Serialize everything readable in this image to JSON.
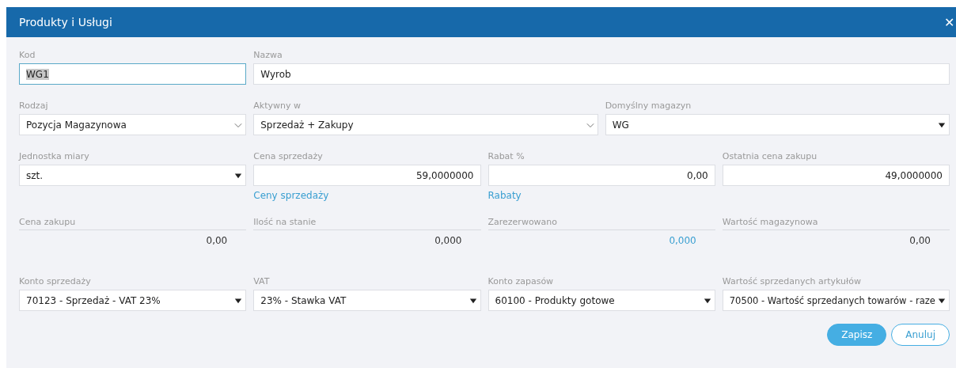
{
  "window": {
    "title": "Produkty i Usługi",
    "close": "✕"
  },
  "rows": [
    {
      "fields": [
        {
          "kind": "text",
          "label": "Kod",
          "value": "WG1",
          "focused": true
        },
        {
          "kind": "text",
          "label": "Nazwa",
          "value": "Wyrob",
          "focused": false
        }
      ]
    },
    {
      "fields": [
        {
          "kind": "select",
          "label": "Rodzaj",
          "value": "Pozycja Magazynowa"
        },
        {
          "kind": "select",
          "label": "Aktywny w",
          "value": "Sprzedaż + Zakupy"
        },
        {
          "kind": "dropdown",
          "label": "Domyślny magazyn",
          "value": "WG"
        }
      ]
    },
    {
      "fields": [
        {
          "kind": "dropdown",
          "label": "Jednostka miary",
          "value": "szt."
        },
        {
          "kind": "number",
          "label": "Cena sprzedaży",
          "value": "59,0000000",
          "focused": false,
          "link": "Ceny sprzedaży"
        },
        {
          "kind": "number",
          "label": "Rabat %",
          "value": "0,00",
          "focused": false,
          "link": "Rabaty"
        },
        {
          "kind": "number",
          "label": "Ostatnia cena zakupu",
          "value": "49,0000000",
          "focused": false
        }
      ]
    },
    {
      "fields": [
        {
          "kind": "readonly",
          "label": "Cena zakupu",
          "value": "0,00",
          "linked": false
        },
        {
          "kind": "readonly",
          "label": "Ilość na stanie",
          "value": "0,000",
          "linked": false
        },
        {
          "kind": "readonly",
          "label": "Zarezerwowano",
          "value": "0,000",
          "linked": true
        },
        {
          "kind": "readonly",
          "label": "Wartość magazynowa",
          "value": "0,00",
          "linked": false
        }
      ]
    },
    {
      "fields": [
        {
          "kind": "dropdown",
          "label": "Konto sprzedaży",
          "value": "70123 - Sprzedaż - VAT 23%"
        },
        {
          "kind": "dropdown",
          "label": "VAT",
          "value": "23% - Stawka VAT"
        },
        {
          "kind": "dropdown",
          "label": "Konto zapasów",
          "value": "60100 - Produkty gotowe"
        },
        {
          "kind": "dropdown",
          "label": "Wartość sprzedanych artykułów",
          "value": "70500 - Wartość sprzedanych towarów - raze"
        }
      ]
    }
  ],
  "buttons": [
    {
      "label": "Zapisz",
      "kind": "primary"
    },
    {
      "label": "Anuluj",
      "kind": "secondary"
    }
  ]
}
